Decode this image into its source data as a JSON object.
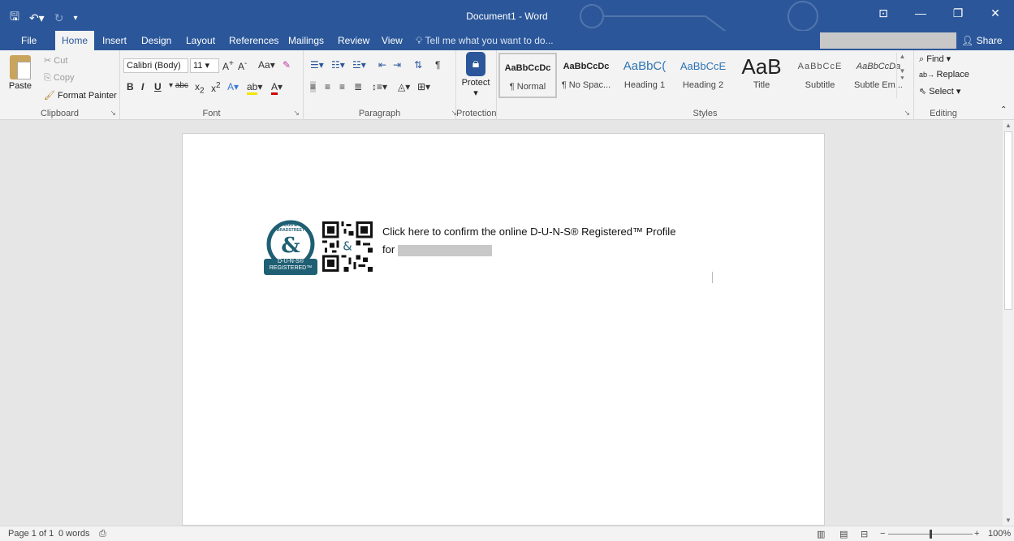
{
  "window": {
    "title": "Document1 - Word",
    "minimize_icon": "minimize-icon",
    "restore_icon": "restore-icon",
    "close_icon": "close-icon",
    "ribbon_display_icon": "ribbon-display-options-icon"
  },
  "qat": {
    "save_icon": "save-icon",
    "undo_icon": "undo-icon",
    "redo_icon": "redo-icon",
    "customize_icon": "customize-qat-icon"
  },
  "tabs": [
    "File",
    "Home",
    "Insert",
    "Design",
    "Layout",
    "References",
    "Mailings",
    "Review",
    "View"
  ],
  "active_tab": "Home",
  "tell_me": "Tell me what you want to do...",
  "share": "Share",
  "ribbon": {
    "clipboard": {
      "label": "Clipboard",
      "paste": "Paste",
      "cut": "Cut",
      "copy": "Copy",
      "format_painter": "Format Painter"
    },
    "font": {
      "label": "Font",
      "font_name": "Calibri (Body)",
      "font_size": "11",
      "change_case": "Aa"
    },
    "paragraph": {
      "label": "Paragraph"
    },
    "protection": {
      "label": "Protection",
      "protect": "Protect"
    },
    "styles": {
      "label": "Styles",
      "items": [
        {
          "preview": "AaBbCcDc",
          "name": "¶ Normal",
          "selected": true
        },
        {
          "preview": "AaBbCcDc",
          "name": "¶ No Spac..."
        },
        {
          "preview": "AaBbC(",
          "name": "Heading 1"
        },
        {
          "preview": "AaBbCcE",
          "name": "Heading 2"
        },
        {
          "preview": "AaB",
          "name": "Title"
        },
        {
          "preview": "AaBbCcE",
          "name": "Subtitle"
        },
        {
          "preview": "AaBbCcDa",
          "name": "Subtle Em..."
        }
      ]
    },
    "editing": {
      "label": "Editing",
      "find": "Find",
      "replace": "Replace",
      "select": "Select"
    }
  },
  "document": {
    "seal_line1": "DUN & BRADSTREET",
    "seal_line2": "D-U-N-S®",
    "seal_line3": "REGISTERED™",
    "confirm_text": "Click here to confirm the online D-U-N-S® Registered™ Profile",
    "for_text": "for"
  },
  "status": {
    "page": "Page 1 of 1",
    "words": "0 words",
    "zoom": "100%",
    "zoom_level": 1.0
  },
  "colors": {
    "accent": "#2b579a",
    "seal": "#1f5f73"
  }
}
